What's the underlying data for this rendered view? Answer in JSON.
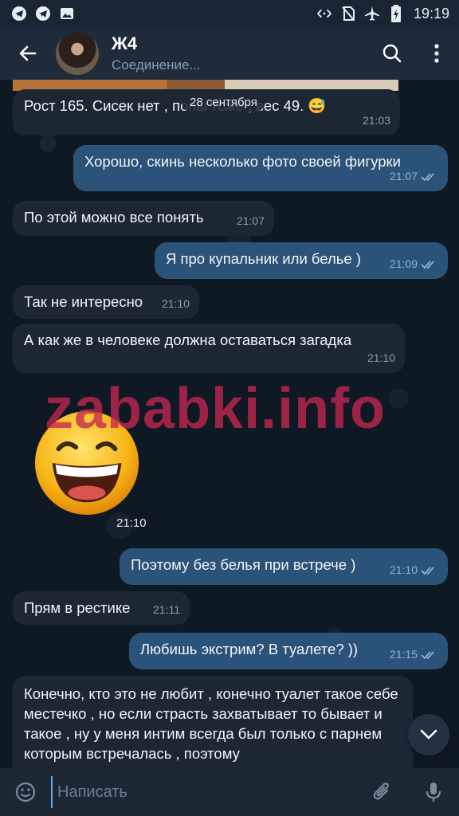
{
  "status_bar": {
    "time": "19:19",
    "left_icons": [
      "telegram-icon",
      "telegram-icon",
      "image-icon"
    ],
    "right_icons": [
      "data-saver-icon",
      "no-sim-icon",
      "airplane-icon",
      "battery-charging-icon"
    ]
  },
  "header": {
    "title": "Ж4",
    "status": "Соединение..."
  },
  "chat": {
    "date_label": "28 сентября",
    "messages": [
      {
        "dir": "in",
        "text": "Рост 165. Сисек нет , попы тоже , вес 49. 😅",
        "time": "21:03"
      },
      {
        "dir": "out",
        "text": "Хорошо, скинь несколько фото своей фигурки",
        "time": "21:07"
      },
      {
        "dir": "in",
        "text": "По этой можно все понять",
        "time": "21:07"
      },
      {
        "dir": "out",
        "text": "Я про купальник или белье )",
        "time": "21:09"
      },
      {
        "dir": "in",
        "text": "Так не интересно",
        "time": "21:10"
      },
      {
        "dir": "in",
        "text": "А как же в человеке должна оставаться загадка",
        "time": "21:10"
      },
      {
        "dir": "out",
        "text": "Поэтому без белья при встрече )",
        "time": "21:10"
      },
      {
        "dir": "in",
        "text": "Прям в рестике",
        "time": "21:11"
      },
      {
        "dir": "out",
        "text": "Любишь экстрим? В туалете? ))",
        "time": "21:15"
      },
      {
        "dir": "in",
        "text": "Конечно, кто это не любит , конечно туалет такое себе местечко , но если страсть захватывает то бывает и такое , ну у меня интим всегда был только с парнем которым встречалась , поэтому",
        "time": ""
      }
    ],
    "sticker": {
      "emoji": "laughing-face-sticker",
      "time": "21:10"
    },
    "watermark": "zababki.info"
  },
  "composer": {
    "placeholder": "Написать"
  },
  "colors": {
    "background": "#0e1621",
    "incoming_bubble": "#1d2733",
    "outgoing_bubble": "#2b5278",
    "accent": "#5ea9e8"
  }
}
